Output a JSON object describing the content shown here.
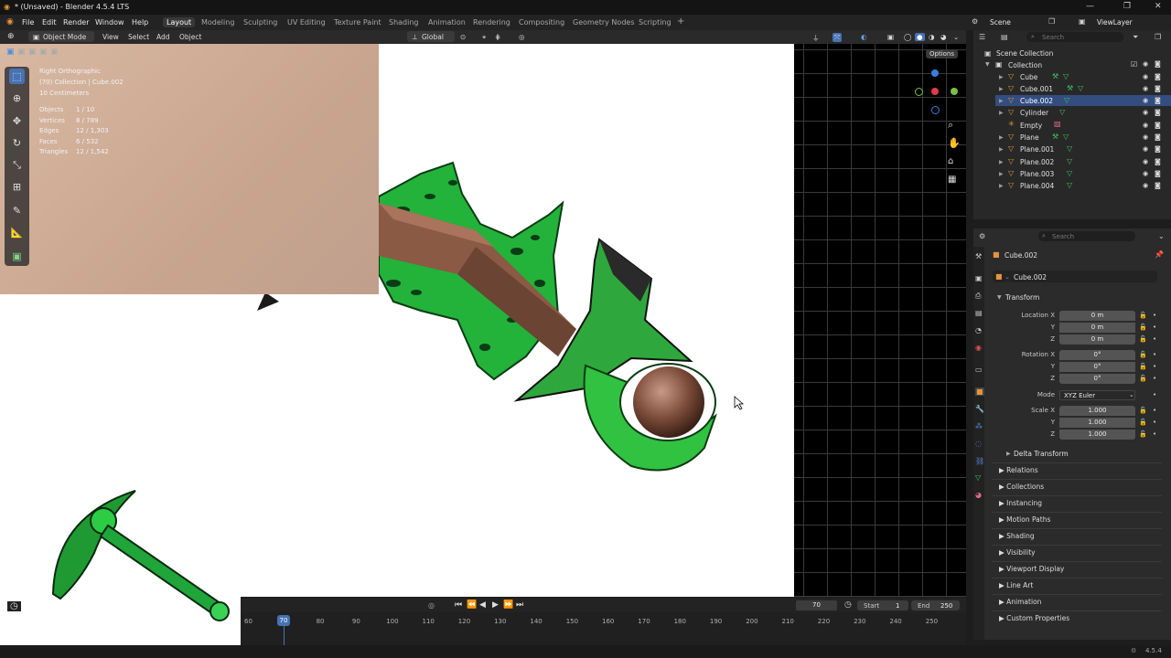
{
  "window": {
    "title": "* (Unsaved) - Blender 4.5.4 LTS"
  },
  "menu": {
    "file": "File",
    "edit": "Edit",
    "render": "Render",
    "window": "Window",
    "help": "Help"
  },
  "workspaces": [
    "Layout",
    "Modeling",
    "Sculpting",
    "UV Editing",
    "Texture Paint",
    "Shading",
    "Animation",
    "Rendering",
    "Compositing",
    "Geometry Nodes",
    "Scripting"
  ],
  "workspace_add": "+",
  "scene": {
    "label": "Scene",
    "viewlayer": "ViewLayer"
  },
  "viewport_header": {
    "mode": "Object Mode",
    "view": "View",
    "select": "Select",
    "add": "Add",
    "object": "Object",
    "orientation": "Global",
    "options": "Options"
  },
  "overlay_info": {
    "view_name": "Right Orthographic",
    "collection_line": "(70) Collection | Cube.002",
    "scale_line": "10 Centimeters",
    "stats": [
      {
        "label": "Objects",
        "value": "1 / 10"
      },
      {
        "label": "Vertices",
        "value": "8 / 789"
      },
      {
        "label": "Edges",
        "value": "12 / 1,303"
      },
      {
        "label": "Faces",
        "value": "6 / 532"
      },
      {
        "label": "Triangles",
        "value": "12 / 1,542"
      }
    ]
  },
  "outliner": {
    "search_placeholder": "Search",
    "scene_collection": "Scene Collection",
    "collection": "Collection",
    "items": [
      {
        "name": "Cube",
        "selected": false
      },
      {
        "name": "Cube.001",
        "selected": false
      },
      {
        "name": "Cube.002",
        "selected": true
      },
      {
        "name": "Cylinder",
        "selected": false
      },
      {
        "name": "Empty",
        "selected": false
      },
      {
        "name": "Plane",
        "selected": false
      },
      {
        "name": "Plane.001",
        "selected": false
      },
      {
        "name": "Plane.002",
        "selected": false
      },
      {
        "name": "Plane.003",
        "selected": false
      },
      {
        "name": "Plane.004",
        "selected": false
      }
    ]
  },
  "properties": {
    "search_placeholder": "Search",
    "object_name": "Cube.002",
    "data_name": "Cube.002",
    "transform": "Transform",
    "location_label": "Location X",
    "rotation_label": "Rotation X",
    "scale_label": "Scale X",
    "mode_label": "Mode",
    "axis_y": "Y",
    "axis_z": "Z",
    "location": [
      "0 m",
      "0 m",
      "0 m"
    ],
    "rotation": [
      "0°",
      "0°",
      "0°"
    ],
    "scale": [
      "1.000",
      "1.000",
      "1.000"
    ],
    "mode_value": "XYZ Euler",
    "delta_transform": "Delta Transform",
    "sections": [
      "Relations",
      "Collections",
      "Instancing",
      "Motion Paths",
      "Shading",
      "Visibility",
      "Viewport Display",
      "Line Art",
      "Animation",
      "Custom Properties"
    ]
  },
  "timeline": {
    "current_frame": "70",
    "frame_field": "70",
    "start_label": "Start",
    "start_value": "1",
    "end_label": "End",
    "end_value": "250",
    "ticks": [
      "60",
      "70",
      "80",
      "90",
      "100",
      "110",
      "120",
      "130",
      "140",
      "150",
      "160",
      "170",
      "180",
      "190",
      "200",
      "210",
      "220",
      "230",
      "240",
      "250"
    ]
  },
  "status": {
    "version": "4.5.4"
  },
  "icons": {
    "select": "select-box-icon",
    "cursor": "cursor-icon",
    "move": "move-icon",
    "rotate": "rotate-icon",
    "scale": "scale-icon",
    "transform": "transform-icon",
    "annotate": "annotate-icon",
    "measure": "measure-icon",
    "add_cube": "add-cube-icon"
  },
  "colors": {
    "accent": "#4772b3",
    "object_orange": "#e4953a",
    "mesh_green": "#46c25f"
  }
}
